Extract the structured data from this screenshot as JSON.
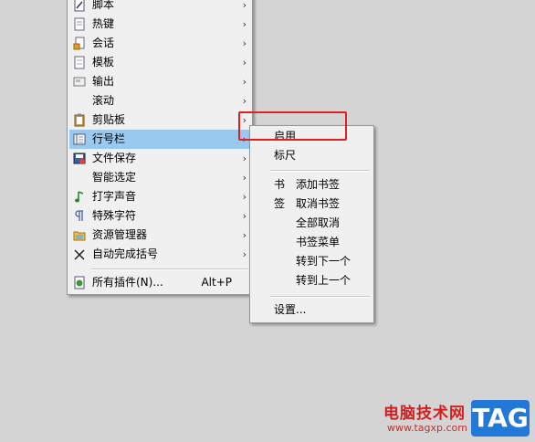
{
  "main_menu": {
    "items": [
      {
        "label": "脚本",
        "icon": "script-icon"
      },
      {
        "label": "热键",
        "icon": "hotkey-icon"
      },
      {
        "label": "会话",
        "icon": "session-icon"
      },
      {
        "label": "模板",
        "icon": "template-icon"
      },
      {
        "label": "输出",
        "icon": "output-icon"
      },
      {
        "label": "滚动",
        "icon": ""
      },
      {
        "label": "剪贴板",
        "icon": "clipboard-icon"
      },
      {
        "label": "行号栏",
        "icon": "line-number-icon"
      },
      {
        "label": "文件保存",
        "icon": "save-file-icon"
      },
      {
        "label": "智能选定",
        "icon": ""
      },
      {
        "label": "打字声音",
        "icon": "music-note-icon"
      },
      {
        "label": "特殊字符",
        "icon": "pilcrow-icon"
      },
      {
        "label": "资源管理器",
        "icon": "folder-icon"
      },
      {
        "label": "自动完成括号",
        "icon": "brackets-icon"
      }
    ],
    "plugins": {
      "label": "所有插件(N)...",
      "shortcut": "Alt+P",
      "icon": "plugins-icon"
    },
    "arrow": "›"
  },
  "sub_menu": {
    "enable": "启用",
    "ruler": "标尺",
    "bookmark_prefix_1": "书",
    "bookmark_prefix_2": "签",
    "add_bookmark": "添加书签",
    "remove_bookmark": "取消书签",
    "clear_all": "全部取消",
    "bookmark_menu": "书签菜单",
    "next": "转到下一个",
    "prev": "转到上一个",
    "settings": "设置..."
  },
  "watermark": {
    "site": "电脑技术网",
    "url": "www.tagxp.com",
    "tag": "TAG"
  },
  "colors": {
    "highlight": "#99c9ef",
    "callout": "#e02020"
  }
}
